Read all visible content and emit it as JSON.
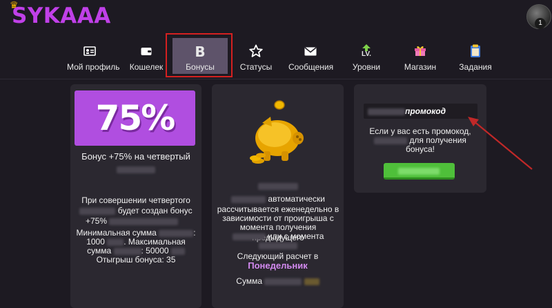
{
  "brand": {
    "logo_text": "SYKAAA",
    "accent": "#c040e8"
  },
  "user": {
    "badge_count": "1"
  },
  "nav": {
    "items": [
      {
        "label": "Мой профиль",
        "icon": "id-card-icon"
      },
      {
        "label": "Кошелек",
        "icon": "wallet-icon"
      },
      {
        "label": "Бонусы",
        "icon": "bonus-b-icon"
      },
      {
        "label": "Статусы",
        "icon": "star-icon"
      },
      {
        "label": "Сообщения",
        "icon": "envelope-icon"
      },
      {
        "label": "Уровни",
        "icon": "level-up-icon"
      },
      {
        "label": "Магазин",
        "icon": "gift-icon"
      },
      {
        "label": "Задания",
        "icon": "clipboard-icon"
      }
    ],
    "level_icon_text": "LV.",
    "bonus_icon_text": "B"
  },
  "card_deposit": {
    "percent": "75%",
    "title": "Бонус +75% на четвертый",
    "line1": "При совершении четвертого",
    "line2": "будет создан бонус",
    "line3": "+75%",
    "min_label": "Минимальная сумма",
    "min_value": "1000",
    "max_label": "Максимальная",
    "max_prefix": "сумма",
    "max_value": ": 50000",
    "wager": "Отыгрыш бонуса: 35"
  },
  "card_cashback": {
    "l1": "автоматически",
    "l2": "рассчитывается еженедельно в",
    "l3": "зависимости от проигрыша с",
    "l4": "момента получения предыдущего",
    "l5": "или с момента",
    "next_label": "Следующий расчет в",
    "next_day": "Понедельник",
    "sum_label": "Сумма"
  },
  "card_promo": {
    "field_suffix": "промокод",
    "hint1": "Если у вас есть промокод,",
    "hint2": "для получения",
    "hint3": "бонуса!"
  },
  "colors": {
    "active_outline": "#d52020",
    "arrow": "#c02828",
    "button_green": "#4fbf3a"
  }
}
